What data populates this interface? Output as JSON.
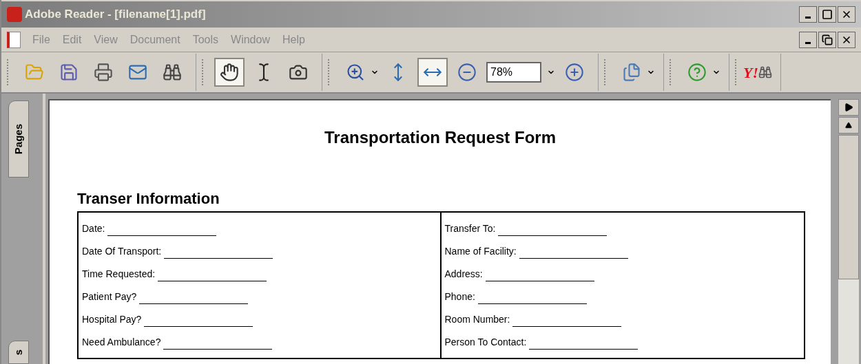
{
  "window": {
    "title": "Adobe Reader - [filename[1].pdf]"
  },
  "menu": [
    "File",
    "Edit",
    "View",
    "Document",
    "Tools",
    "Window",
    "Help"
  ],
  "toolbar": {
    "groups": [
      {
        "buttons": [
          {
            "selected": false
          },
          {
            "selected": false
          },
          {
            "selected": false
          },
          {
            "selected": false
          },
          {
            "selected": false
          }
        ]
      },
      {
        "buttons": [
          {
            "selected": true
          },
          {
            "selected": false
          },
          {
            "selected": false
          }
        ]
      },
      {
        "buttons": [
          {
            "selected": false
          },
          {
            "selected": false
          },
          {
            "selected": true
          },
          {
            "selected": false
          },
          {
            "selected": false
          }
        ]
      },
      {
        "buttons": [
          {
            "selected": false
          }
        ]
      },
      {
        "buttons": [
          {
            "selected": false
          }
        ]
      }
    ],
    "zoom": "78%",
    "search_logo": "Y!"
  },
  "side_tabs": [
    {
      "label": "Pages"
    },
    {
      "label": "s"
    }
  ],
  "document": {
    "title": "Transportation Request Form",
    "section": "Transer Information",
    "left_fields": [
      "Date:",
      "Date Of Transport:",
      "Time Requested:",
      "Patient Pay?",
      "Hospital Pay?",
      "Need Ambulance?"
    ],
    "right_fields": [
      "Transfer To:",
      "Name of Facility:",
      "Address:",
      "Phone:",
      "Room Number:",
      "Person To Contact:"
    ]
  }
}
